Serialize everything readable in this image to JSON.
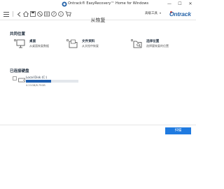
{
  "window": {
    "title": "Ontrack® EasyRecovery™ Home for Windows",
    "min_glyph": "—",
    "max_glyph": "☐",
    "close_glyph": "✕"
  },
  "toolbar": {
    "icons": [
      "hamburger-menu-icon",
      "back-icon",
      "home-icon",
      "save-scan-icon",
      "stop-icon",
      "scan-status-icon",
      "help-icon",
      "info-icon",
      "cart-icon"
    ],
    "advanced_tools_label": "高级工具",
    "caret": "▾",
    "brand": "Ontrack"
  },
  "page": {
    "title": "从恢复"
  },
  "common_locations": {
    "heading": "共同位置",
    "items": [
      {
        "name": "桌面",
        "desc": "从桌面恢复数据",
        "icon": "desktop-icon"
      },
      {
        "name": "文件资料",
        "desc": "从文档中恢复",
        "icon": "documents-folder-icon"
      },
      {
        "name": "选择位置",
        "desc": "选择要恢复的位置",
        "icon": "select-location-icon"
      }
    ]
  },
  "connected_drives": {
    "heading": "已连接硬盘",
    "drives": [
      {
        "name": "Local Disk (C:)",
        "size": "4.21GB/8.75GB",
        "used_fraction": 0.48,
        "icon": "hard-drive-icon"
      }
    ]
  },
  "footer": {
    "scan_button": "扫描"
  },
  "colors": {
    "accent": "#1f7ae0",
    "brand": "#2563a8",
    "drive_bar": "#1f5fb0"
  }
}
